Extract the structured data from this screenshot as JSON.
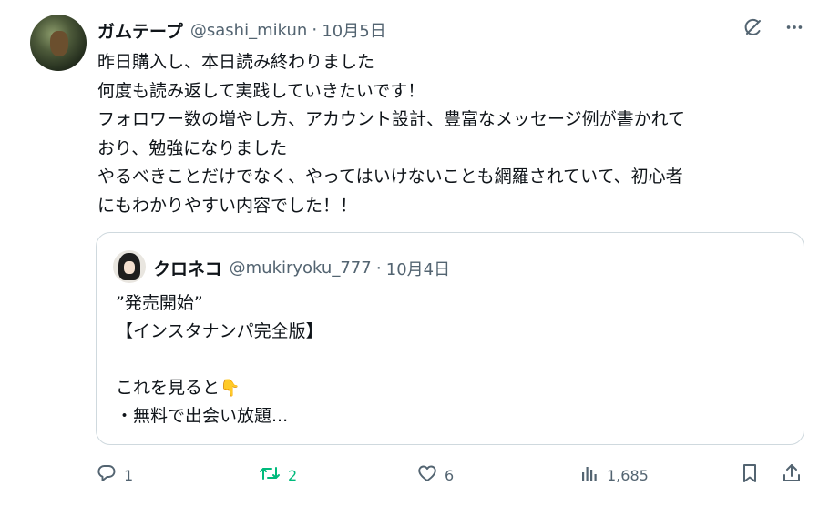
{
  "author": {
    "name": "ガムテープ",
    "handle": "@sashi_mikun",
    "separator": "·",
    "date": "10月5日"
  },
  "tweet_lines": [
    "昨日購入し、本日読み終わりました",
    "何度も読み返して実践していきたいです！",
    "フォロワー数の増やし方、アカウント設計、豊富なメッセージ例が書かれて",
    "おり、勉強になりました",
    "やるべきことだけでなく、やってはいけないことも網羅されていて、初心者",
    "にもわかりやすい内容でした！！"
  ],
  "quote": {
    "name": "クロネコ",
    "handle": "@mukiryoku_777",
    "separator": "·",
    "date": "10月4日",
    "lines": [
      "”発売開始”",
      "【インスタナンパ完全版】",
      "",
      "これを見ると",
      "・無料で出会い放題..."
    ],
    "emoji": "👇"
  },
  "stats": {
    "replies": "1",
    "retweets": "2",
    "likes": "6",
    "views": "1,685"
  },
  "icons": {
    "top": [
      "grok-icon",
      "more-icon"
    ],
    "actions": [
      "reply-icon",
      "retweet-icon",
      "like-icon",
      "views-icon",
      "bookmark-icon",
      "share-icon"
    ]
  },
  "colors": {
    "text": "#0f1419",
    "secondary": "#536471",
    "retweet_active": "#00ba7c",
    "border": "#cfd9de"
  }
}
